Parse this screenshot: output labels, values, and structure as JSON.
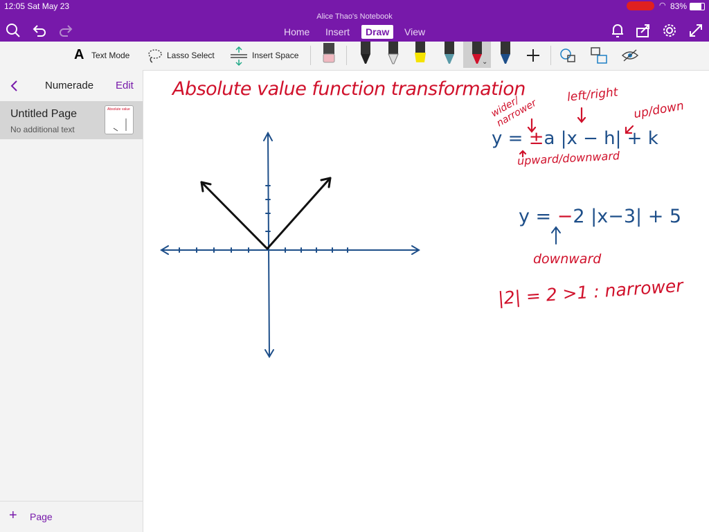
{
  "status": {
    "time_date": "12:05   Sat May 23",
    "battery": "83%"
  },
  "window_title": "Alice Thao's Notebook",
  "tabs": [
    "Home",
    "Insert",
    "Draw",
    "View"
  ],
  "ribbon": {
    "text_mode": "Text Mode",
    "lasso_select": "Lasso Select",
    "insert_space": "Insert Space"
  },
  "sidebar": {
    "section_title": "Numerade",
    "edit_label": "Edit",
    "page_title": "Untitled Page",
    "page_subtitle": "No additional text",
    "thumbnail_text": "Absolute value",
    "add_page_label": "Page"
  },
  "notes": {
    "title": "Absolute value function transformation",
    "label_wider_narrower": "wider/ narrower",
    "label_left_right": "left/right",
    "label_up_down": "up/down",
    "general_formula_prefix": "y = ",
    "general_sign": "±",
    "general_formula_rest": "a |x − h| + k",
    "label_upward_downward": "upward/downward",
    "example_formula_prefix": "y = ",
    "example_sign": "−",
    "example_formula_rest": "2 |x−3| + 5",
    "label_downward": "downward",
    "conclusion": "|2| = 2 >1 : narrower"
  },
  "colors": {
    "accent": "#7719aa",
    "ink_red": "#d0112b",
    "ink_blue": "#1d4e89"
  }
}
